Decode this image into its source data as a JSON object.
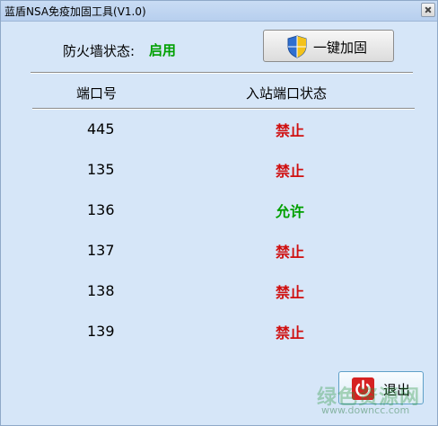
{
  "window": {
    "title": "蓝盾NSA免疫加固工具(V1.0)"
  },
  "firewall": {
    "label": "防火墙状态:",
    "status": "启用"
  },
  "toolbar": {
    "harden_label": "一键加固",
    "exit_label": "退出"
  },
  "table": {
    "headers": {
      "port": "端口号",
      "status": "入站端口状态"
    },
    "rows": [
      {
        "port": "445",
        "state": "禁止"
      },
      {
        "port": "135",
        "state": "禁止"
      },
      {
        "port": "136",
        "state": "允许"
      },
      {
        "port": "137",
        "state": "禁止"
      },
      {
        "port": "138",
        "state": "禁止"
      },
      {
        "port": "139",
        "state": "禁止"
      }
    ]
  },
  "watermark": {
    "brand": "绿色资源网",
    "url": "www.downcc.com"
  },
  "colors": {
    "enabled": "#00a000",
    "forbidden": "#d01010",
    "allowed": "#00a000"
  },
  "icons": {
    "close": "close-icon",
    "shield": "shield-icon",
    "power": "power-icon"
  }
}
